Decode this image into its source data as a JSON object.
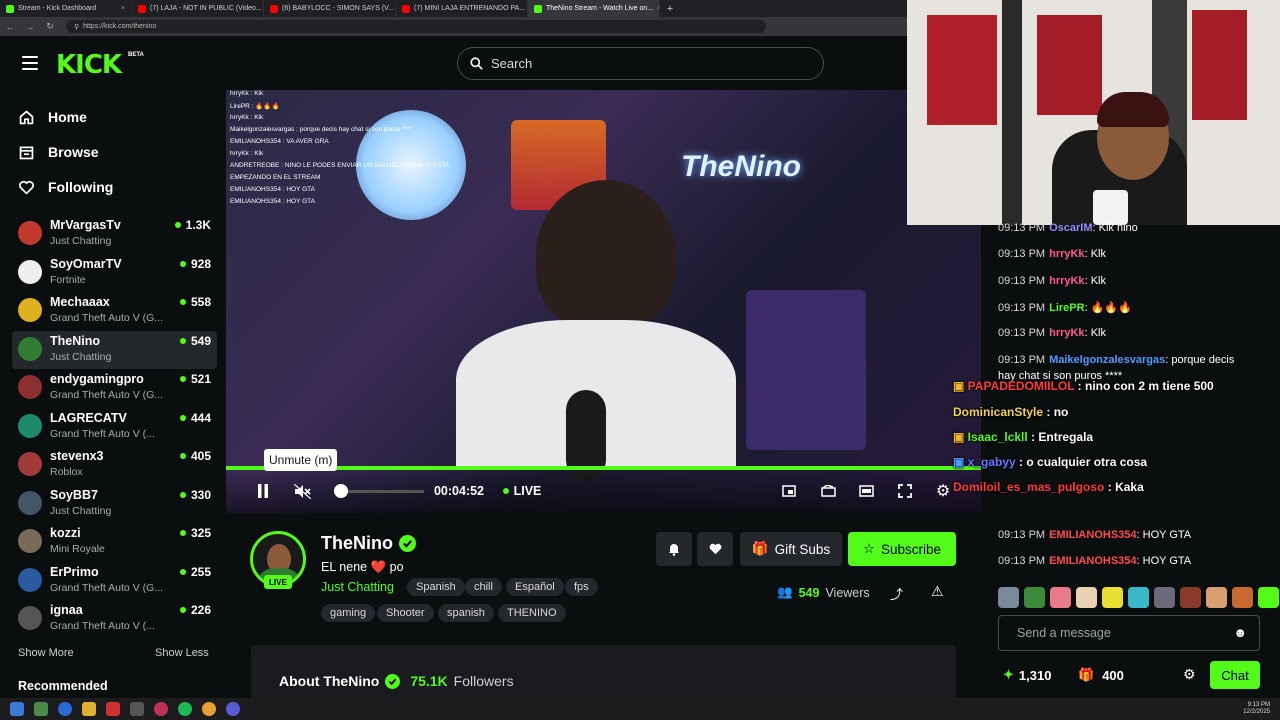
{
  "browser": {
    "tabs": [
      {
        "label": "Stream - Kick Dashboard",
        "color": "#53fc18"
      },
      {
        "label": "(7) LAJA - NOT IN PUBLIC (Video...",
        "color": "#ff0000"
      },
      {
        "label": "(6) BABYLOCC - SIMON SAYS (V...",
        "color": "#ff0000"
      },
      {
        "label": "(7) MINI LAJA ENTRENANDO PA...",
        "color": "#ff0000"
      },
      {
        "label": "TheNino Stream - Watch Live on...",
        "color": "#53fc18"
      }
    ],
    "url": "https://kick.com/thenino"
  },
  "header": {
    "logo": "KICK",
    "beta": "BETA",
    "search_placeholder": "Search"
  },
  "sidebar": {
    "nav": [
      {
        "label": "Home",
        "icon": "home-icon"
      },
      {
        "label": "Browse",
        "icon": "browse-icon"
      },
      {
        "label": "Following",
        "icon": "heart-icon"
      }
    ],
    "channels": [
      {
        "name": "MrVargasTv",
        "category": "Just Chatting",
        "viewers": "1.3K",
        "color": "#c0392b"
      },
      {
        "name": "SoyOmarTV",
        "category": "Fortnite",
        "viewers": "928",
        "color": "#eeeeee"
      },
      {
        "name": "Mechaaax",
        "category": "Grand Theft Auto V (G...",
        "viewers": "558",
        "color": "#e0b020"
      },
      {
        "name": "TheNino",
        "category": "Just Chatting",
        "viewers": "549",
        "color": "#2e7d32"
      },
      {
        "name": "endygamingpro",
        "category": "Grand Theft Auto V (G...",
        "viewers": "521",
        "color": "#8e2f2f"
      },
      {
        "name": "LAGRECATV",
        "category": "Grand Theft Auto V (...",
        "viewers": "444",
        "color": "#1a8a6a"
      },
      {
        "name": "stevenx3",
        "category": "Roblox",
        "viewers": "405",
        "color": "#a33a3a"
      },
      {
        "name": "SoyBB7",
        "category": "Just Chatting",
        "viewers": "330",
        "color": "#445566"
      },
      {
        "name": "kozzi",
        "category": "Mini Royale",
        "viewers": "325",
        "color": "#7a6a5a"
      },
      {
        "name": "ErPrimo",
        "category": "Grand Theft Auto V (G...",
        "viewers": "255",
        "color": "#2a5aa0"
      },
      {
        "name": "ignaa",
        "category": "Grand Theft Auto V (...",
        "viewers": "226",
        "color": "#555555"
      }
    ],
    "show_more": "Show More",
    "show_less": "Show Less",
    "recommended": "Recommended"
  },
  "player": {
    "overlay_chat": [
      "hrryKk : Klk",
      "LirePR : 🔥🔥🔥",
      "hrryKk : Klk",
      "Maikelgonzalesvargas : porque decis hay chat si son puros ****",
      "EMILIANOHS354 : VA AVER GRA",
      "hrryKk : Klk",
      "ANDRETREOBE : NINO LE PODES ENVIAR UN SALUDO A LEAL Q ESTA",
      "EMPEZANDO EN EL STREAM",
      "EMILIANOHS354 : HOY GTA",
      "EMILIANOHS354 : HOY GTA"
    ],
    "neon_text": "TheNino",
    "tooltip": "Unmute (m)",
    "time": "00:04:52",
    "live": "LIVE",
    "progress": 1.0
  },
  "chat": {
    "messages": [
      {
        "time": "09:13 PM",
        "user": "OscarIM",
        "color": "#9b8cff",
        "text": "Klk nino"
      },
      {
        "time": "09:13 PM",
        "user": "hrryKk",
        "color": "#ff5b8a",
        "text": "Klk"
      },
      {
        "time": "09:13 PM",
        "user": "hrryKk",
        "color": "#ff5b8a",
        "text": "Klk"
      },
      {
        "time": "09:13 PM",
        "user": "LirePR",
        "color": "#53fc18",
        "text": "🔥🔥🔥"
      },
      {
        "time": "09:13 PM",
        "user": "hrryKk",
        "color": "#ff5b8a",
        "text": "Klk"
      },
      {
        "time": "09:13 PM",
        "user": "Maikelgonzalesvargas",
        "color": "#4e9bff",
        "text": "porque decis"
      },
      {
        "time": "",
        "user": "",
        "color": "#ffffff",
        "text": "hay chat si son puros ****"
      },
      {
        "time": "09:13 PM",
        "user": "EMILIANOHS354",
        "color": "#ff4b4b",
        "text": "HOY GTA"
      },
      {
        "time": "09:13 PM",
        "user": "EMILIANOHS354",
        "color": "#ff4b4b",
        "text": "HOY GTA"
      }
    ],
    "overlay_messages": [
      {
        "user": "PAPADEDOMIILOL",
        "color": "#ff3b3b",
        "text": "nino con 2 m tiene 500"
      },
      {
        "user": "DominicanStyle",
        "color": "#f1d34b",
        "text": "no"
      },
      {
        "user": "Isaac_lckll",
        "color": "#53fc18",
        "text": "Entregala"
      },
      {
        "user": "x_gabyy",
        "color": "#5f7bff",
        "text": "o cualquier otra cosa"
      },
      {
        "user": "Domiloil_es_mas_pulgoso",
        "color": "#ff3b3b",
        "text": "Kaka"
      }
    ],
    "input_placeholder": "Send a message",
    "points": "1,310",
    "gifts": "400",
    "chat_button": "Chat"
  },
  "stream": {
    "streamer": "TheNino",
    "live_badge": "LIVE",
    "title": "EL nene ❤️ po",
    "category": "Just Chatting",
    "tags_row1": [
      "Spanish",
      "chill",
      "Español",
      "fps"
    ],
    "tags_row2": [
      "gaming",
      "Shooter",
      "spanish",
      "THENINO"
    ],
    "gift_subs": "Gift Subs",
    "subscribe": "Subscribe",
    "viewers_count": "549",
    "viewers_label": "Viewers",
    "about_label": "About TheNino",
    "followers_count": "75.1K",
    "followers_label": "Followers"
  },
  "taskbar": {
    "time": "9:13 PM",
    "date": "12/2/2025"
  },
  "colors": {
    "accent": "#53fc18",
    "background": "#0b0e0f"
  }
}
